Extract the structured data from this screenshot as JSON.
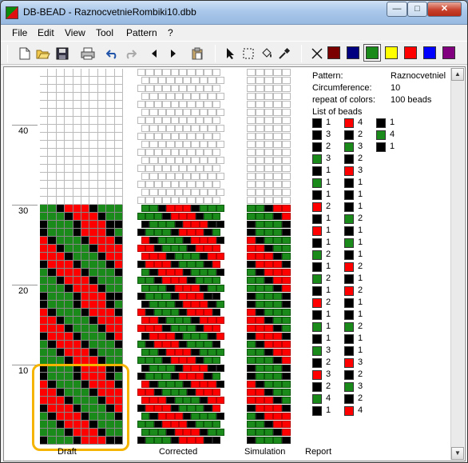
{
  "window": {
    "title": "DB-BEAD - RaznocvetnieRombiki10.dbb",
    "controls": {
      "minimize": "—",
      "maximize": "□",
      "close": "✕"
    }
  },
  "menu": [
    "File",
    "Edit",
    "View",
    "Tool",
    "Pattern",
    "?"
  ],
  "toolbar": {
    "icons": [
      "new-file-icon",
      "open-folder-icon",
      "save-disk-icon",
      "print-icon",
      "undo-icon",
      "redo-icon",
      "arrow-left-icon",
      "arrow-right-icon",
      "paste-icon",
      "pointer-icon",
      "select-rect-icon",
      "fill-bucket-icon",
      "eyedropper-icon",
      "none-color-icon"
    ],
    "colors": [
      "#7a0000",
      "#000080",
      "#1a8a1a",
      "#ffff00",
      "#ff0000",
      "#0000ff",
      "#800080"
    ],
    "selected_color": "#1a8a1a"
  },
  "ruler": [
    "40",
    "30",
    "20",
    "10"
  ],
  "tabs": [
    "Draft",
    "Corrected",
    "Simulation",
    "Report"
  ],
  "info": {
    "pattern_label": "Pattern:",
    "pattern_value": "Raznocvetniel",
    "circ_label": "Circumference:",
    "circ_value": "10",
    "repeat_label": "repeat of colors:",
    "repeat_value": "100 beads",
    "list_title": "List of beads"
  },
  "bead_list": [
    [
      [
        "k",
        "1"
      ],
      [
        "k",
        "3"
      ],
      [
        "k",
        "2"
      ],
      [
        "g",
        "3"
      ],
      [
        "k",
        "1"
      ],
      [
        "g",
        "1"
      ],
      [
        "k",
        "1"
      ],
      [
        "r",
        "2"
      ],
      [
        "k",
        "1"
      ],
      [
        "r",
        "1"
      ],
      [
        "k",
        "1"
      ],
      [
        "g",
        "2"
      ],
      [
        "k",
        "1"
      ],
      [
        "g",
        "2"
      ],
      [
        "k",
        "1"
      ],
      [
        "r",
        "2"
      ],
      [
        "k",
        "1"
      ],
      [
        "g",
        "1"
      ],
      [
        "k",
        "1"
      ],
      [
        "g",
        "3"
      ],
      [
        "k",
        "2"
      ],
      [
        "r",
        "3"
      ],
      [
        "k",
        "2"
      ],
      [
        "g",
        "4"
      ],
      [
        "k",
        "1"
      ]
    ],
    [
      [
        "r",
        "4"
      ],
      [
        "k",
        "2"
      ],
      [
        "g",
        "3"
      ],
      [
        "k",
        "2"
      ],
      [
        "r",
        "3"
      ],
      [
        "k",
        "1"
      ],
      [
        "k",
        "1"
      ],
      [
        "k",
        "1"
      ],
      [
        "g",
        "2"
      ],
      [
        "k",
        "1"
      ],
      [
        "g",
        "1"
      ],
      [
        "k",
        "1"
      ],
      [
        "r",
        "2"
      ],
      [
        "k",
        "1"
      ],
      [
        "r",
        "2"
      ],
      [
        "k",
        "1"
      ],
      [
        "k",
        "1"
      ],
      [
        "g",
        "2"
      ],
      [
        "k",
        "1"
      ],
      [
        "k",
        "1"
      ],
      [
        "r",
        "3"
      ],
      [
        "k",
        "2"
      ],
      [
        "g",
        "3"
      ],
      [
        "k",
        "2"
      ],
      [
        "r",
        "4"
      ]
    ],
    [
      [
        "k",
        "1"
      ],
      [
        "g",
        "4"
      ],
      [
        "k",
        "1"
      ]
    ]
  ],
  "draft_rows": [
    "kgggkrrrkk",
    "gggkrrrkgg",
    "ggkrrrkggg",
    "gkrrrkgggk",
    "krrrkgggkr",
    "rrrkgggkrr",
    "rrkgggkrrr",
    "rkgggkrrrk",
    "kgggkrrrkg",
    "kgggkrrrkk",
    "gggkrrrkgg",
    "ggkrrrkggg",
    "gkrrrkgggk",
    "krrrkgggkr",
    "rrrkgggkrr",
    "rrkgggkrrr",
    "rkgggkrrrk",
    "kgggkrrrkg",
    "kgggkrrrkk",
    "gggkrrrkgg",
    "ggkrrrkggg",
    "gkrrrkgggk",
    "krrrkgggkr",
    "rrrkgggkrr",
    "rrkgggkrrr",
    "rkgggkrrrk",
    "kgggkrrrkg",
    "kgggkrrrkk",
    "gggkrrrkgg",
    "ggkrrrkggg"
  ]
}
